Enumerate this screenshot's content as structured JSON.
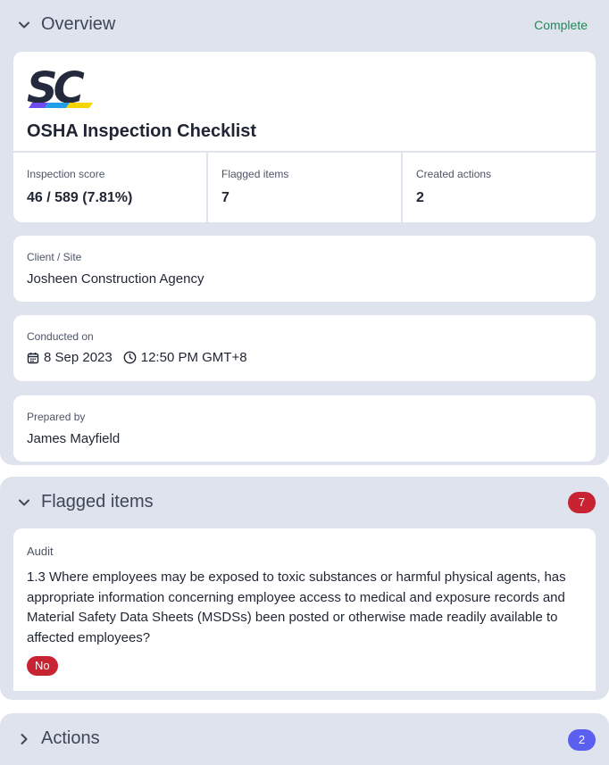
{
  "overview": {
    "title": "Overview",
    "status": "Complete",
    "logo_text": "SC",
    "document_title": "OSHA Inspection Checklist",
    "stats": [
      {
        "label": "Inspection score",
        "value": "46 / 589 (7.81%)"
      },
      {
        "label": "Flagged items",
        "value": "7"
      },
      {
        "label": "Created actions",
        "value": "2"
      }
    ],
    "client": {
      "label": "Client / Site",
      "value": "Josheen Construction Agency"
    },
    "conducted": {
      "label": "Conducted on",
      "date": "8 Sep 2023",
      "time": "12:50 PM GMT+8"
    },
    "prepared": {
      "label": "Prepared by",
      "value": "James Mayfield"
    }
  },
  "flagged": {
    "title": "Flagged items",
    "count": "7",
    "count_color": "#c82333",
    "item": {
      "category": "Audit",
      "question": "1.3 Where employees may be exposed to toxic substances or harmful physical agents, has appropriate information concerning employee access to medical and exposure records and Material Safety Data Sheets (MSDSs) been posted or otherwise made readily available to affected employees?",
      "answer": "No"
    }
  },
  "actions": {
    "title": "Actions",
    "count": "2",
    "count_color": "#5b5ff0"
  },
  "colors": {
    "section_bg": "#dfe3ee",
    "status_complete": "#1f8a55",
    "answer_no": "#c82333"
  },
  "icons": [
    "chevron-down-icon",
    "chevron-right-icon",
    "calendar-icon",
    "clock-icon",
    "sc-logo"
  ]
}
